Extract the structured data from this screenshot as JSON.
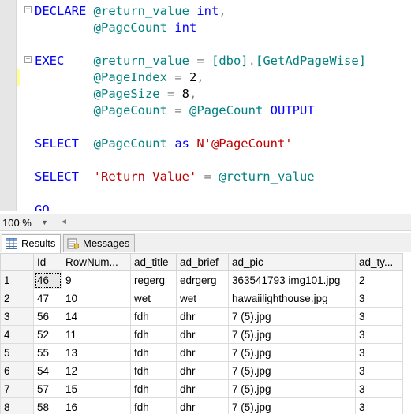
{
  "editor": {
    "lines": [
      {
        "parts": [
          {
            "t": "DECLARE ",
            "c": "kw"
          },
          {
            "t": "@return_value ",
            "c": "id"
          },
          {
            "t": "int",
            "c": "kw"
          },
          {
            "t": ",",
            "c": "gray"
          }
        ]
      },
      {
        "parts": [
          {
            "t": "        ",
            "c": "plain"
          },
          {
            "t": "@PageCount ",
            "c": "id"
          },
          {
            "t": "int",
            "c": "kw"
          }
        ]
      },
      {
        "parts": []
      },
      {
        "parts": [
          {
            "t": "EXEC    ",
            "c": "kw"
          },
          {
            "t": "@return_value ",
            "c": "id"
          },
          {
            "t": "= ",
            "c": "gray"
          },
          {
            "t": "[dbo]",
            "c": "id"
          },
          {
            "t": ".",
            "c": "gray"
          },
          {
            "t": "[GetAdPageWise]",
            "c": "id"
          }
        ]
      },
      {
        "parts": [
          {
            "t": "        ",
            "c": "plain"
          },
          {
            "t": "@PageIndex ",
            "c": "id"
          },
          {
            "t": "= ",
            "c": "gray"
          },
          {
            "t": "2",
            "c": "plain"
          },
          {
            "t": ",",
            "c": "gray"
          }
        ]
      },
      {
        "parts": [
          {
            "t": "        ",
            "c": "plain"
          },
          {
            "t": "@PageSize ",
            "c": "id"
          },
          {
            "t": "= ",
            "c": "gray"
          },
          {
            "t": "8",
            "c": "plain"
          },
          {
            "t": ",",
            "c": "gray"
          }
        ]
      },
      {
        "parts": [
          {
            "t": "        ",
            "c": "plain"
          },
          {
            "t": "@PageCount ",
            "c": "id"
          },
          {
            "t": "= ",
            "c": "gray"
          },
          {
            "t": "@PageCount ",
            "c": "id"
          },
          {
            "t": "OUTPUT",
            "c": "kw"
          }
        ]
      },
      {
        "parts": []
      },
      {
        "parts": [
          {
            "t": "SELECT  ",
            "c": "kw"
          },
          {
            "t": "@PageCount ",
            "c": "id"
          },
          {
            "t": "as ",
            "c": "kw"
          },
          {
            "t": "N'@PageCount'",
            "c": "str"
          }
        ]
      },
      {
        "parts": []
      },
      {
        "parts": [
          {
            "t": "SELECT  ",
            "c": "kw"
          },
          {
            "t": "'Return Value' ",
            "c": "str"
          },
          {
            "t": "= ",
            "c": "gray"
          },
          {
            "t": "@return_value",
            "c": "id"
          }
        ]
      },
      {
        "parts": []
      },
      {
        "parts": [
          {
            "t": "GO",
            "c": "kw"
          }
        ]
      }
    ],
    "outline_expand_glyph": "−"
  },
  "zoom": {
    "value": "100 %",
    "arrow": "▼",
    "scroll_left": "◄"
  },
  "tabs": [
    {
      "label": "Results",
      "icon": "grid-icon",
      "active": true
    },
    {
      "label": "Messages",
      "icon": "messages-icon",
      "active": false
    }
  ],
  "grid": {
    "columns": [
      "Id",
      "RowNum...",
      "ad_title",
      "ad_brief",
      "ad_pic",
      "ad_ty..."
    ],
    "rows": [
      [
        "1",
        "46",
        "9",
        "regerg",
        "edrgerg",
        "363541793 img101.jpg",
        "2"
      ],
      [
        "2",
        "47",
        "10",
        "wet",
        "wet",
        "hawaiilighthouse.jpg",
        "3"
      ],
      [
        "3",
        "56",
        "14",
        "fdh",
        "dhr",
        "7 (5).jpg",
        "3"
      ],
      [
        "4",
        "52",
        "11",
        "fdh",
        "dhr",
        "7 (5).jpg",
        "3"
      ],
      [
        "5",
        "55",
        "13",
        "fdh",
        "dhr",
        "7 (5).jpg",
        "3"
      ],
      [
        "6",
        "54",
        "12",
        "fdh",
        "dhr",
        "7 (5).jpg",
        "3"
      ],
      [
        "7",
        "57",
        "15",
        "fdh",
        "dhr",
        "7 (5).jpg",
        "3"
      ],
      [
        "8",
        "58",
        "16",
        "fdh",
        "dhr",
        "7 (5).jpg",
        "3"
      ]
    ]
  }
}
